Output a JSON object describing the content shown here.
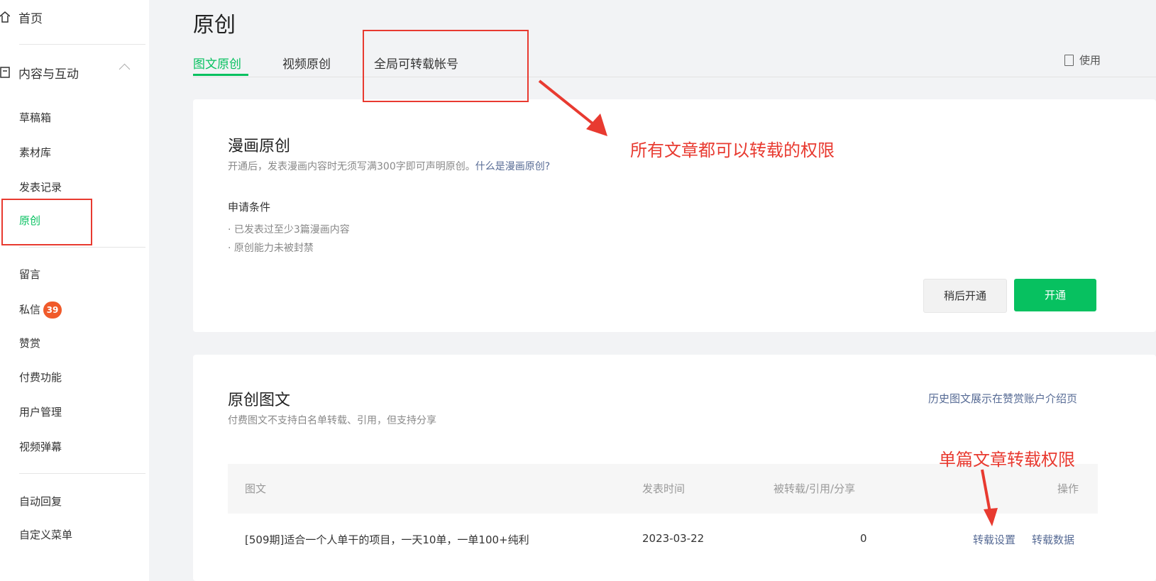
{
  "sidebar": {
    "home_label": "首页",
    "content_group_label": "内容与互动",
    "items": [
      {
        "label": "草稿箱"
      },
      {
        "label": "素材库"
      },
      {
        "label": "发表记录"
      },
      {
        "label": "原创"
      },
      {
        "label": "留言"
      },
      {
        "label": "私信",
        "badge": "39"
      },
      {
        "label": "赞赏"
      },
      {
        "label": "付费功能"
      },
      {
        "label": "用户管理"
      },
      {
        "label": "视频弹幕"
      },
      {
        "label": "自动回复"
      },
      {
        "label": "自定义菜单"
      }
    ],
    "active_color": "#07c160",
    "badge_color": "#f05a2a"
  },
  "header": {
    "title": "原创",
    "tabs": [
      {
        "label": "图文原创",
        "active": true
      },
      {
        "label": "视频原创",
        "active": false
      },
      {
        "label": "全局可转载帐号",
        "active": false
      }
    ],
    "help_link": "使用"
  },
  "comic_card": {
    "title": "漫画原创",
    "desc_prefix": "开通后，发表漫画内容时无须写满300字即可声明原创。",
    "desc_link": "什么是漫画原创?",
    "conditions_title": "申请条件",
    "conditions": [
      "· 已发表过至少3篇漫画内容",
      "· 原创能力未被封禁"
    ],
    "later_button": "稍后开通",
    "open_button": "开通"
  },
  "article_card": {
    "title": "原创图文",
    "desc": "付费图文不支持白名单转载、引用，但支持分享",
    "history_link": "历史图文展示在赞赏账户介绍页",
    "table": {
      "headers": [
        "图文",
        "发表时间",
        "被转载/引用/分享",
        "操作"
      ],
      "rows": [
        {
          "title": "[509期]适合一个人单干的项目，一天10单，一单100+纯利",
          "date": "2023-03-22",
          "count": "0",
          "actions": [
            "转载设置",
            "转载数据"
          ]
        }
      ]
    }
  },
  "annotations": {
    "global_note": "所有文章都可以转载的权限",
    "single_note": "单篇文章转载权限",
    "color": "#e83a30"
  }
}
